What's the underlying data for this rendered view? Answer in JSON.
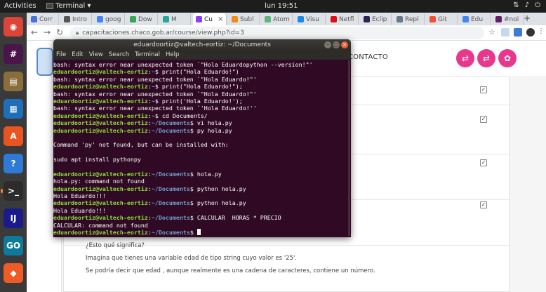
{
  "topbar": {
    "activities": "Activities",
    "app_name": "Terminal ▾",
    "clock": "lun 19:51"
  },
  "browser": {
    "tabs": [
      {
        "label": "Corr",
        "color": "#4a6fd6"
      },
      {
        "label": "Intro",
        "color": "#555555"
      },
      {
        "label": "goog",
        "color": "#4285f4"
      },
      {
        "label": "Dow",
        "color": "#34a853"
      },
      {
        "label": "M",
        "color": "#25a59a"
      },
      {
        "label": "Cu",
        "color": "#8a3ff0",
        "active": true
      },
      {
        "label": "Subl",
        "color": "#f28a1a"
      },
      {
        "label": "Atom",
        "color": "#5fb57d"
      },
      {
        "label": "Visu",
        "color": "#1e88e5"
      },
      {
        "label": "Netfl",
        "color": "#e50914"
      },
      {
        "label": "Eclip",
        "color": "#2c2255"
      },
      {
        "label": "Repl",
        "color": "#667788"
      },
      {
        "label": "Git",
        "color": "#f05033"
      },
      {
        "label": "Edu",
        "color": "#4285f4"
      },
      {
        "label": "#noi",
        "color": "#611f69"
      }
    ],
    "url": "capacitaciones.chaco.gob.ar/course/view.php?id=3"
  },
  "page": {
    "nav_contact": "CONTACTO",
    "paragraphs": [
      "¿Esto qué significa?",
      "Imagina que tienes una variable edad de tipo string cuyo valor es '25'.",
      "Se podría decir que edad , aunque realmente es una cadena de caracteres, contiene un número."
    ]
  },
  "terminal": {
    "title": "eduardoortiz@valtech-eortiz: ~/Documents",
    "menu": [
      "File",
      "Edit",
      "View",
      "Search",
      "Terminal",
      "Help"
    ],
    "lines": [
      {
        "text": "bash: syntax error near unexpected token `\"Hola Eduardopython --version!\"'"
      },
      {
        "user": "eduardoortiz@valtech-eortiz",
        "path": "~",
        "cmd": " print(\"Hola Eduardo!\")"
      },
      {
        "text": "bash: syntax error near unexpected token `\"Hola Eduardo!\"'"
      },
      {
        "user": "eduardoortiz@valtech-eortiz",
        "path": "~",
        "cmd": " print(\"Hola Eduardo!\");"
      },
      {
        "text": "bash: syntax error near unexpected token `\"Hola Eduardo!\"'"
      },
      {
        "user": "eduardoortiz@valtech-eortiz",
        "path": "~",
        "cmd": " print('Hola Eduardo!');"
      },
      {
        "text": "bash: syntax error near unexpected token `'Hola Eduardo!''"
      },
      {
        "user": "eduardoortiz@valtech-eortiz",
        "path": "~",
        "cmd": " cd Documents/"
      },
      {
        "user": "eduardoortiz@valtech-eortiz",
        "path": "~/Documents",
        "cmd": " vi hola.py"
      },
      {
        "user": "eduardoortiz@valtech-eortiz",
        "path": "~/Documents",
        "cmd": " py hola.py"
      },
      {
        "text": ""
      },
      {
        "text": "Command 'py' not found, but can be installed with:"
      },
      {
        "text": ""
      },
      {
        "text": "sudo apt install pythonpy"
      },
      {
        "text": ""
      },
      {
        "user": "eduardoortiz@valtech-eortiz",
        "path": "~/Documents",
        "cmd": " hola.py"
      },
      {
        "text": "hola.py: command not found"
      },
      {
        "user": "eduardoortiz@valtech-eortiz",
        "path": "~/Documents",
        "cmd": " python hola.py"
      },
      {
        "text": "Hola Eduardo!!!"
      },
      {
        "user": "eduardoortiz@valtech-eortiz",
        "path": "~/Documents",
        "cmd": " python hola.py"
      },
      {
        "text": "Hola Eduardo!!!"
      },
      {
        "user": "eduardoortiz@valtech-eortiz",
        "path": "~/Documents",
        "cmd": " CALCULAR  HORAS * PRECIO"
      },
      {
        "text": "CALCULAR: command not found"
      },
      {
        "user": "eduardoortiz@valtech-eortiz",
        "path": "~/Documents",
        "cmd": " ",
        "cursor": true
      }
    ]
  },
  "dock": [
    {
      "name": "chrome-icon",
      "color": "#db4437",
      "glyph": "◉"
    },
    {
      "name": "slack-icon",
      "color": "#4a154b",
      "glyph": "#"
    },
    {
      "name": "files-icon",
      "color": "#8a6d3b",
      "glyph": "▤"
    },
    {
      "name": "writer-icon",
      "color": "#1e6fb8",
      "glyph": "▦"
    },
    {
      "name": "software-icon",
      "color": "#e95420",
      "glyph": "A"
    },
    {
      "name": "help-icon",
      "color": "#2f7ad6",
      "glyph": "?"
    },
    {
      "name": "terminal-icon",
      "color": "#2c2c2c",
      "glyph": ">_",
      "active": true
    },
    {
      "name": "intellij-icon",
      "color": "#1a1a8a",
      "glyph": "IJ"
    },
    {
      "name": "goland-icon",
      "color": "#0b7a9b",
      "glyph": "GO"
    },
    {
      "name": "postman-icon",
      "color": "#ef5b25",
      "glyph": "◆"
    }
  ]
}
